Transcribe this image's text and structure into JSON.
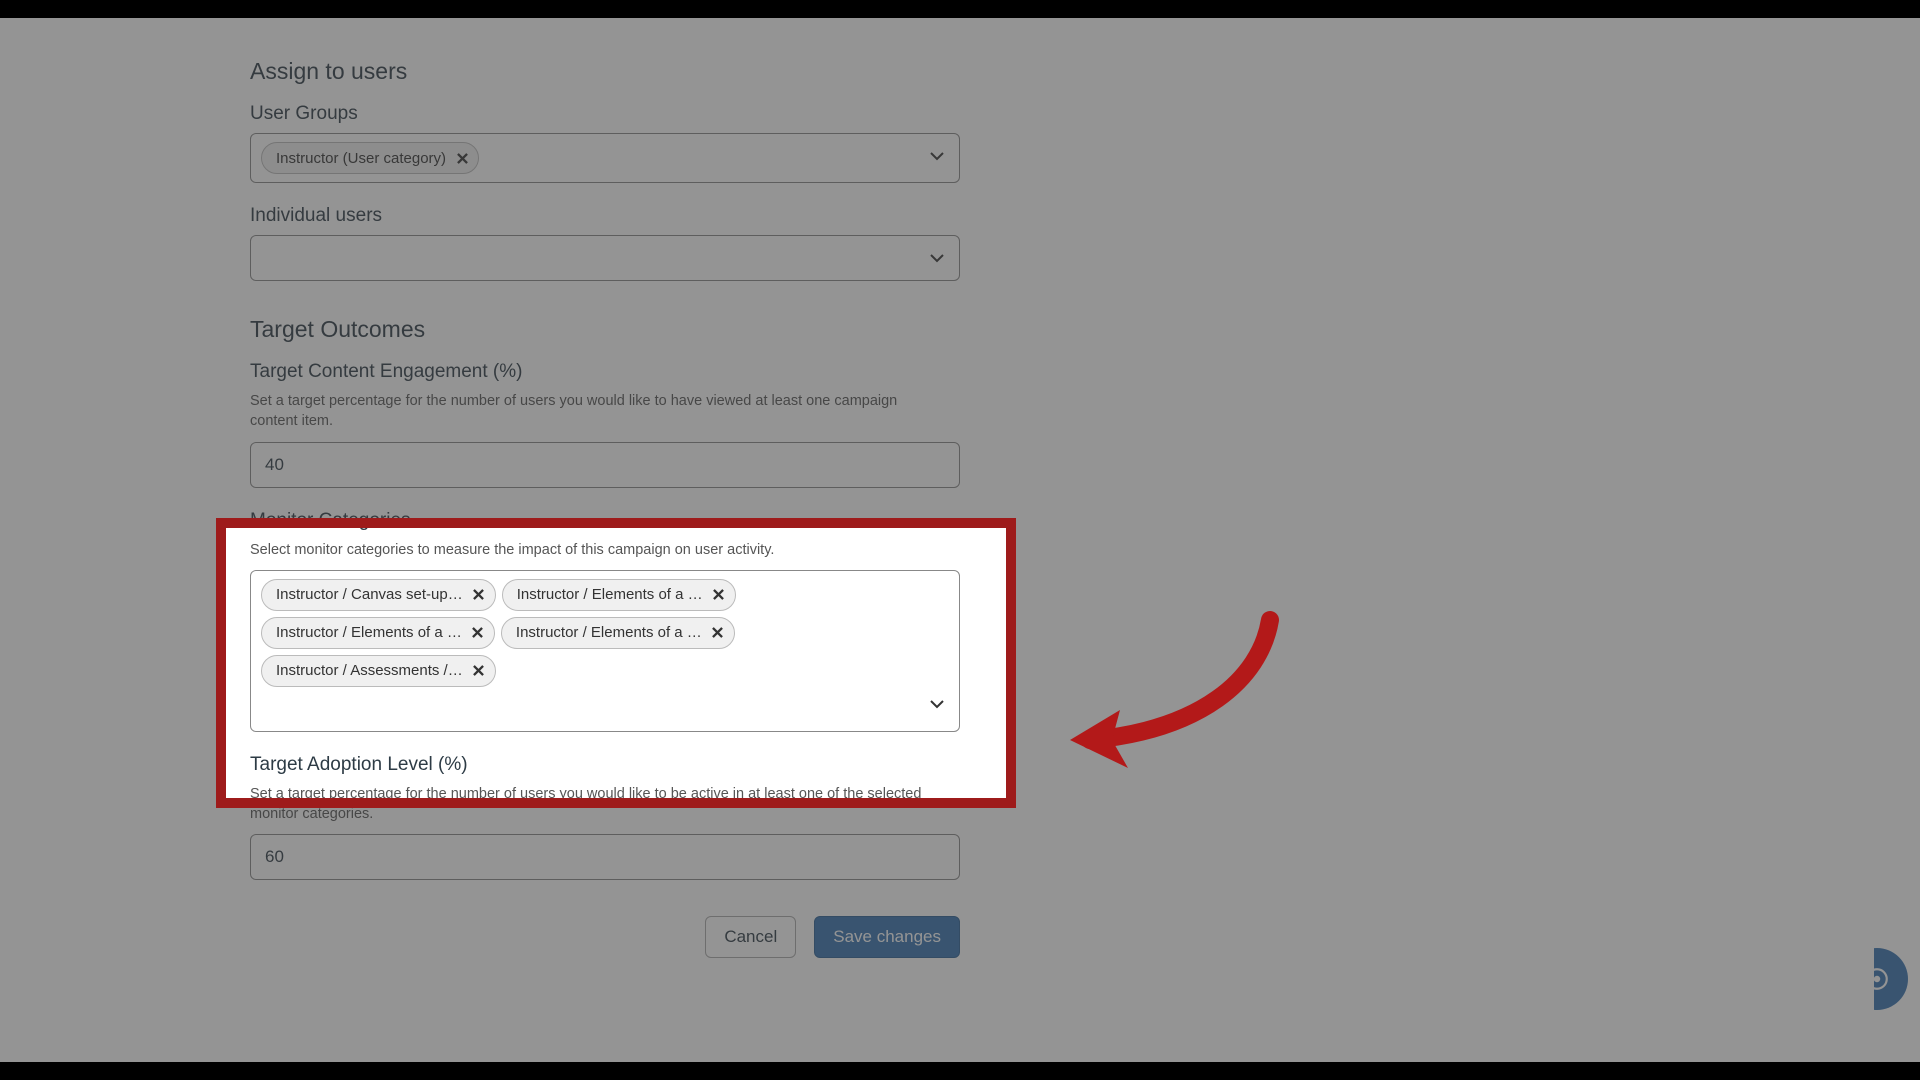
{
  "sections": {
    "assign_title": "Assign to users",
    "outcomes_title": "Target Outcomes"
  },
  "user_groups": {
    "label": "User Groups",
    "chips": [
      {
        "label": "Instructor (User category)"
      }
    ]
  },
  "individual_users": {
    "label": "Individual users"
  },
  "target_engagement": {
    "label": "Target Content Engagement (%)",
    "help": "Set a target percentage for the number of users you would like to have viewed at least one campaign content item.",
    "value": "40"
  },
  "monitor_categories": {
    "label": "Monitor Categories",
    "help": "Select monitor categories to measure the impact of this campaign on user activity.",
    "chips": [
      {
        "label": "Instructor / Canvas set-up…"
      },
      {
        "label": "Instructor / Elements of a …"
      },
      {
        "label": "Instructor / Elements of a …"
      },
      {
        "label": "Instructor / Elements of a …"
      },
      {
        "label": "Instructor / Assessments /…"
      }
    ]
  },
  "target_adoption": {
    "label": "Target Adoption Level (%)",
    "help": "Set a target percentage for the number of users you would like to be active in at least one of the selected monitor categories.",
    "value": "60"
  },
  "buttons": {
    "cancel": "Cancel",
    "save": "Save changes"
  }
}
